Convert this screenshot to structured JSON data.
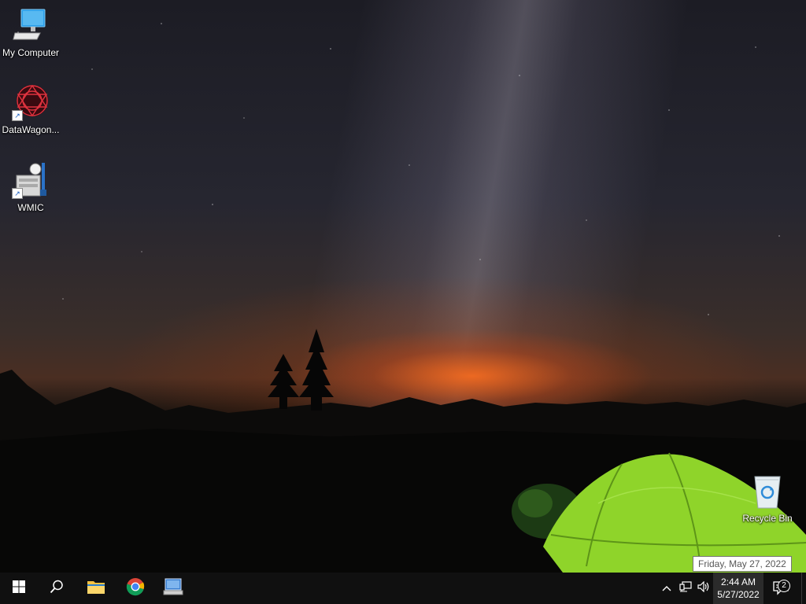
{
  "desktop": {
    "icons": [
      {
        "label": "My Computer",
        "icon": "computer-icon"
      },
      {
        "label": "DataWagon...",
        "icon": "datawagon-icon"
      },
      {
        "label": "WMIC",
        "icon": "wmic-icon"
      },
      {
        "label": "Recycle Bin",
        "icon": "recycle-bin-icon"
      }
    ]
  },
  "tooltip": {
    "text": "Friday, May 27, 2022"
  },
  "taskbar": {
    "pinned": [
      {
        "icon": "windows-start-icon"
      },
      {
        "icon": "search-icon"
      },
      {
        "icon": "file-explorer-icon"
      },
      {
        "icon": "chrome-icon"
      },
      {
        "icon": "network-app-icon"
      }
    ],
    "tray": {
      "icons": [
        "chevron-up-icon",
        "network-icon",
        "volume-icon"
      ],
      "time": "2:44 AM",
      "date": "5/27/2022",
      "notifications": "2"
    }
  },
  "colors": {
    "taskbar": "#101010",
    "clock_highlight": "#2b2b2b",
    "tent": "#8fd42a",
    "glow": "#ff6e1e"
  }
}
